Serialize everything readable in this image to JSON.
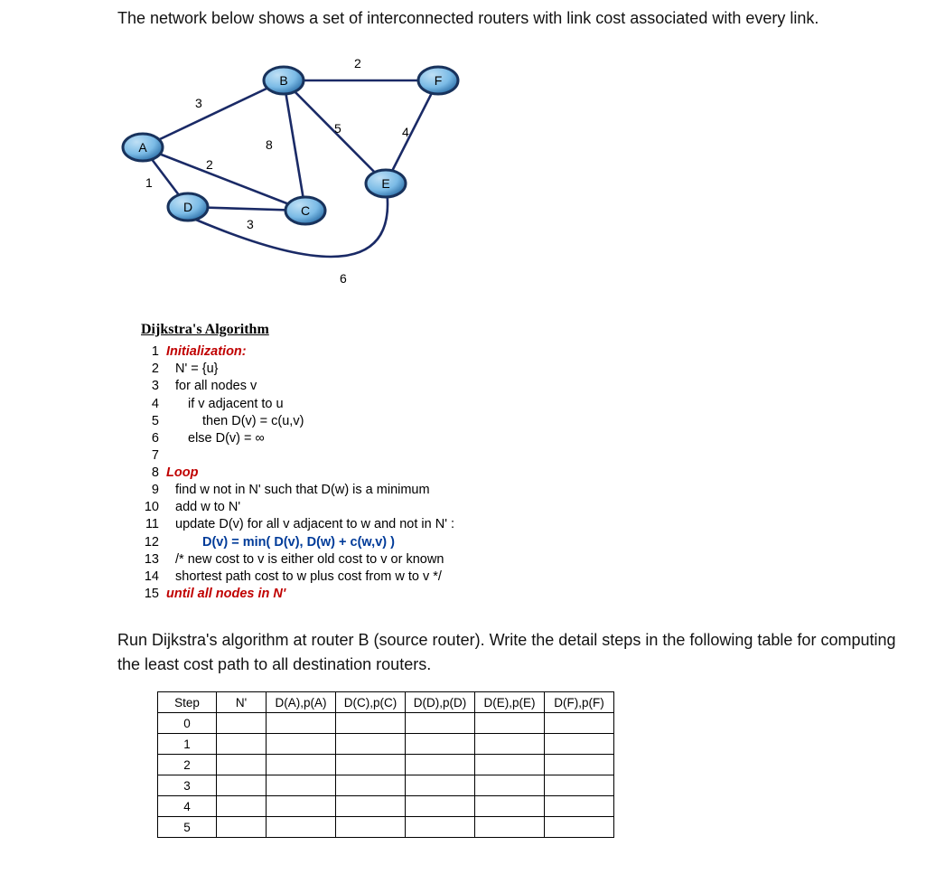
{
  "intro": "The network below shows a set of interconnected routers with link cost associated with every link.",
  "algo_title": "Dijkstra's Algorithm",
  "code": {
    "l1": "Initialization:",
    "l2": "N' = {u}",
    "l3": "for all nodes v",
    "l4": "if v adjacent to u",
    "l5": "then D(v) = c(u,v)",
    "l6": "else D(v) = ∞",
    "l7": "",
    "l8": "Loop",
    "l9": "find w not in N' such that D(w) is a minimum",
    "l10": "add w to N'",
    "l11": "update D(v) for all v adjacent to w and not in N' :",
    "l12": "D(v) = min( D(v), D(w) + c(w,v) )",
    "l13": "/* new cost to v is either old cost to v or known",
    "l14": "shortest path cost to w plus cost from w to v */",
    "l15": "until all nodes in N'"
  },
  "instruction": "Run Dijkstra's algorithm at router B (source router). Write the detail steps in the following table for computing the least cost path to all destination routers.",
  "table": {
    "headers": [
      "Step",
      "N'",
      "D(A),p(A)",
      "D(C),p(C)",
      "D(D),p(D)",
      "D(E),p(E)",
      "D(F),p(F)"
    ],
    "steps": [
      "0",
      "1",
      "2",
      "3",
      "4",
      "5"
    ]
  },
  "graph": {
    "nodes": [
      "A",
      "B",
      "C",
      "D",
      "E",
      "F"
    ],
    "edges": [
      {
        "u": "A",
        "v": "B",
        "w": 3
      },
      {
        "u": "A",
        "v": "D",
        "w": 1
      },
      {
        "u": "A",
        "v": "C",
        "w": 2
      },
      {
        "u": "B",
        "v": "C",
        "w": 8
      },
      {
        "u": "B",
        "v": "E",
        "w": 5
      },
      {
        "u": "B",
        "v": "F",
        "w": 2
      },
      {
        "u": "D",
        "v": "C",
        "w": 3
      },
      {
        "u": "E",
        "v": "F",
        "w": 4
      },
      {
        "u": "E",
        "v": "D",
        "w": 6
      }
    ]
  },
  "chart_data": {
    "type": "table",
    "title": "Dijkstra steps from B",
    "columns": [
      "Step",
      "N'",
      "D(A),p(A)",
      "D(C),p(C)",
      "D(D),p(D)",
      "D(E),p(E)",
      "D(F),p(F)"
    ],
    "rows": [
      [
        "0",
        "",
        "",
        "",
        "",
        "",
        ""
      ],
      [
        "1",
        "",
        "",
        "",
        "",
        "",
        ""
      ],
      [
        "2",
        "",
        "",
        "",
        "",
        "",
        ""
      ],
      [
        "3",
        "",
        "",
        "",
        "",
        "",
        ""
      ],
      [
        "4",
        "",
        "",
        "",
        "",
        "",
        ""
      ],
      [
        "5",
        "",
        "",
        "",
        "",
        "",
        ""
      ]
    ]
  }
}
